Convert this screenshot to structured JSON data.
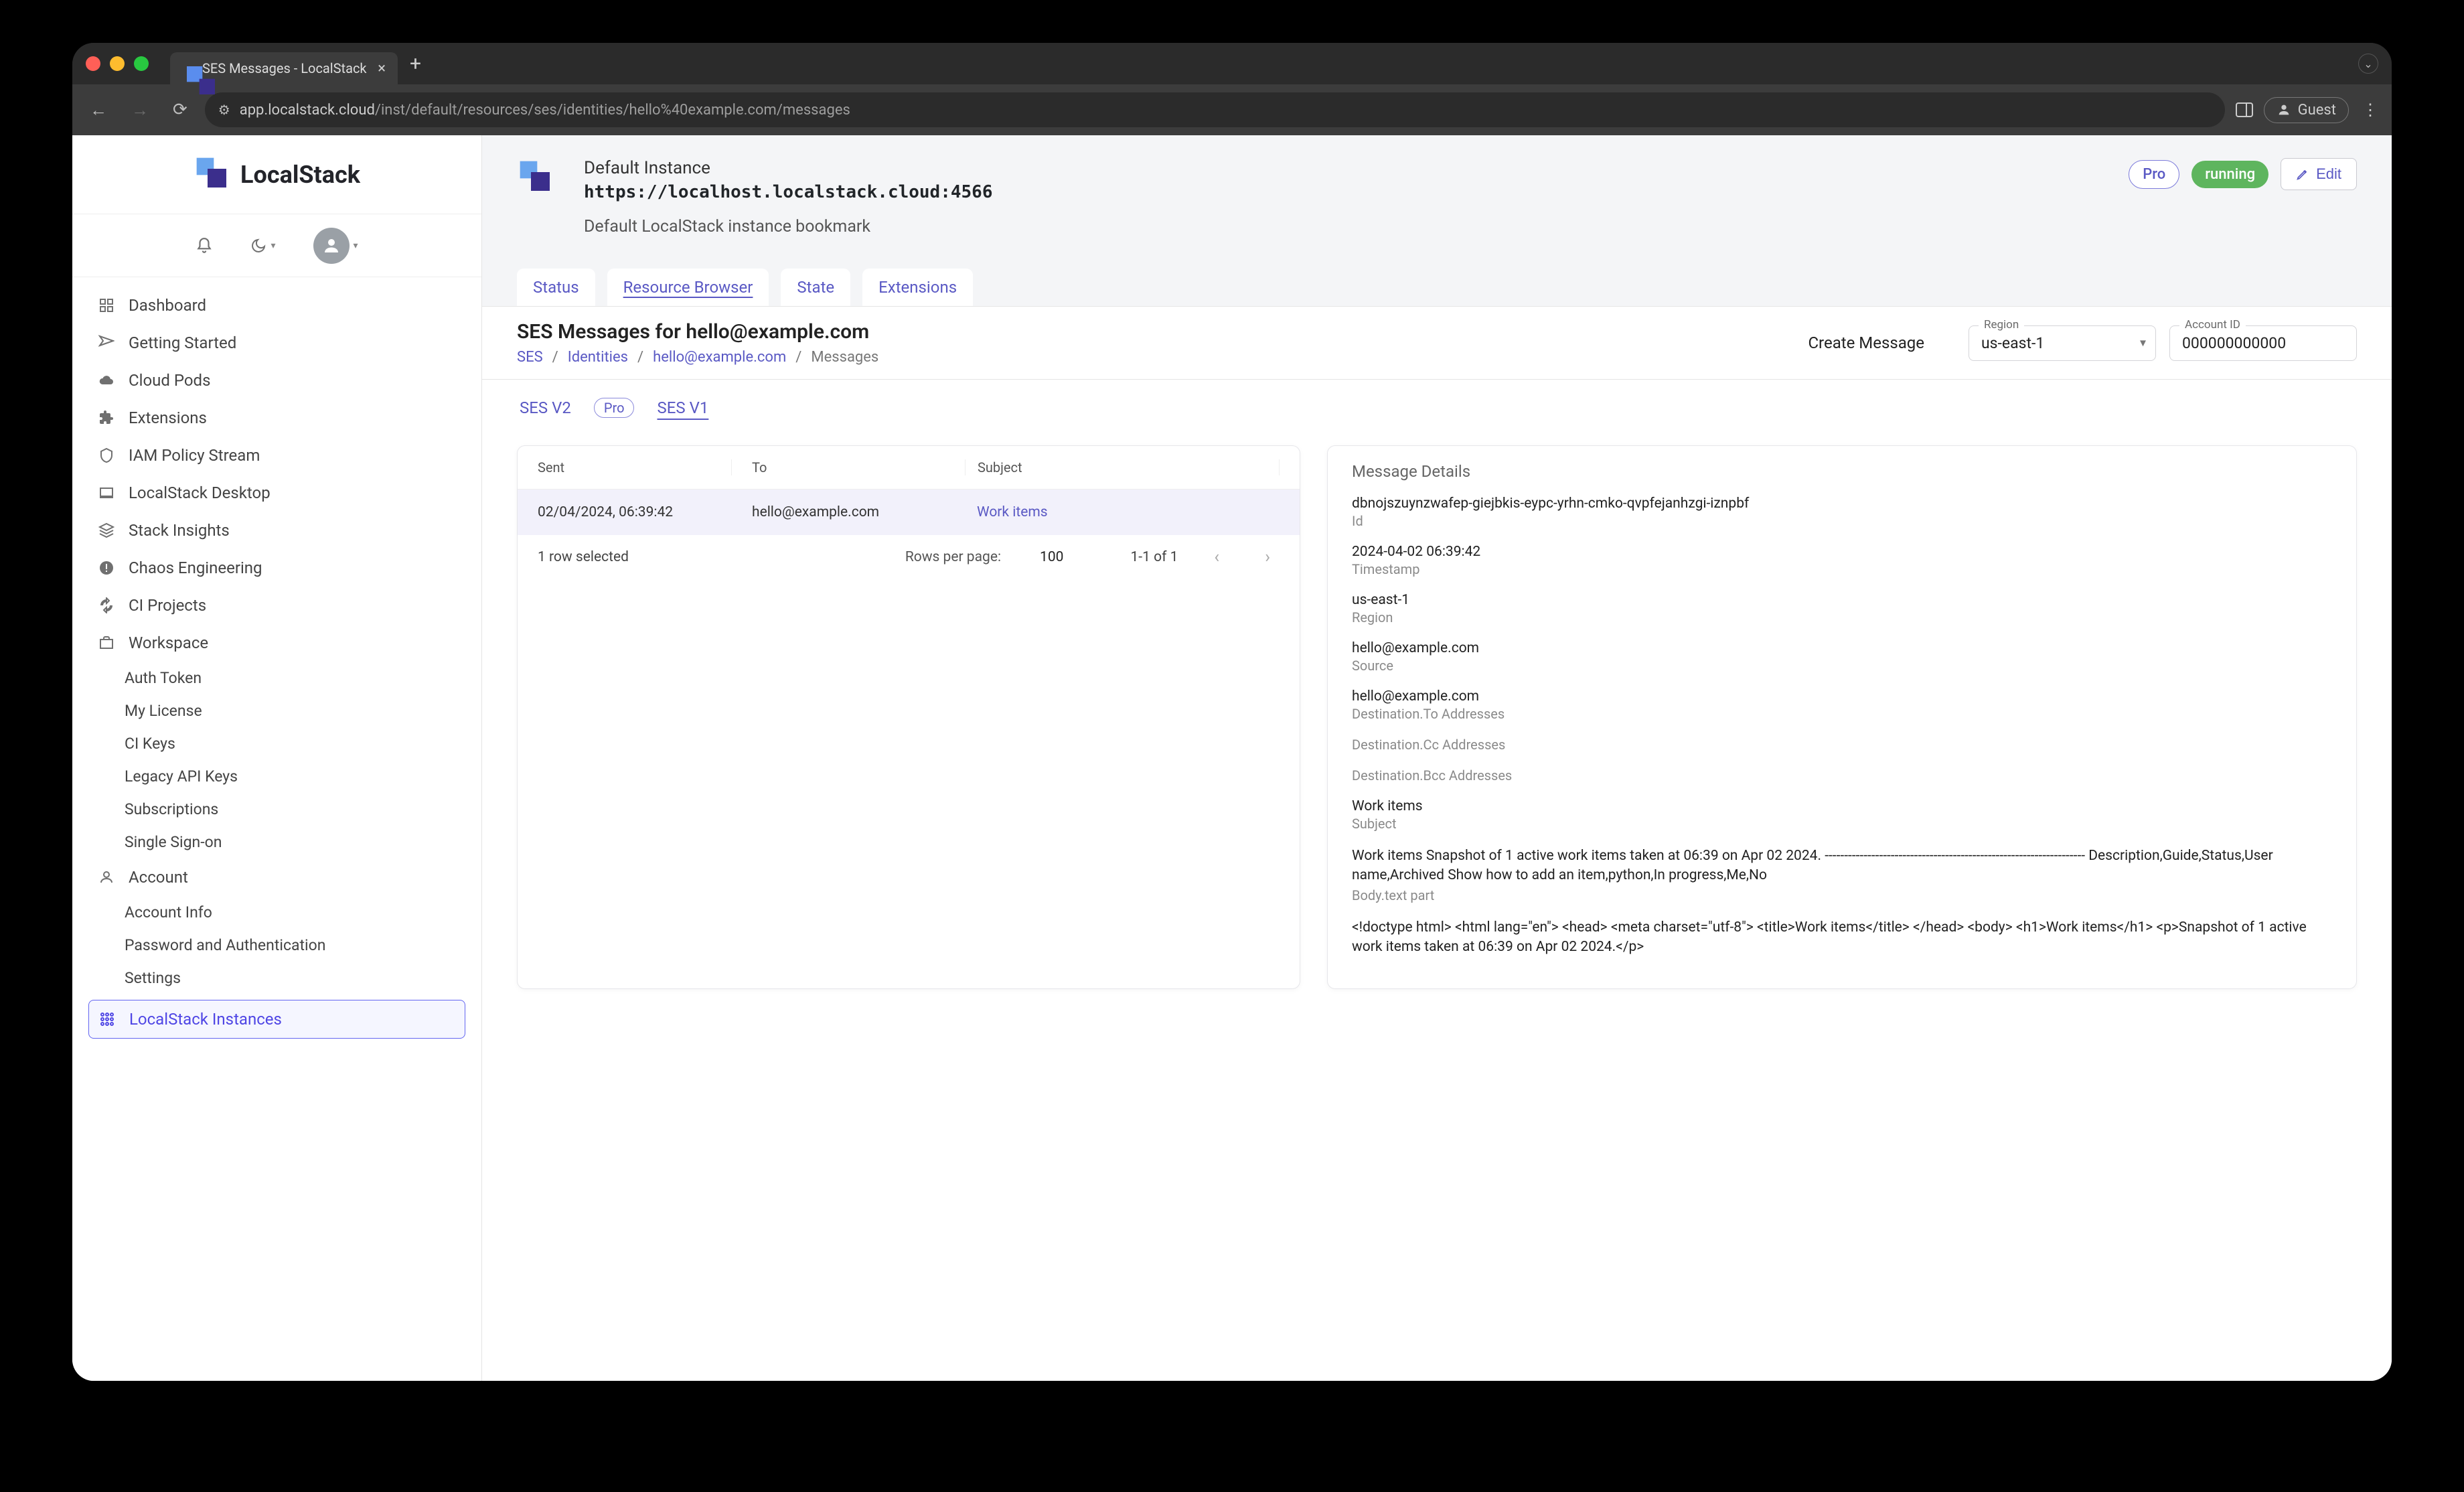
{
  "browser": {
    "tab_title": "SES Messages - LocalStack",
    "url_host": "app.localstack.cloud",
    "url_path": "/inst/default/resources/ses/identities/hello%40example.com/messages",
    "guest_label": "Guest"
  },
  "brand": {
    "name": "LocalStack"
  },
  "sidebar": {
    "items": [
      {
        "label": "Dashboard"
      },
      {
        "label": "Getting Started"
      },
      {
        "label": "Cloud Pods"
      },
      {
        "label": "Extensions"
      },
      {
        "label": "IAM Policy Stream"
      },
      {
        "label": "LocalStack Desktop"
      },
      {
        "label": "Stack Insights"
      },
      {
        "label": "Chaos Engineering"
      },
      {
        "label": "CI Projects"
      },
      {
        "label": "Workspace"
      }
    ],
    "workspace_sub": [
      {
        "label": "Auth Token"
      },
      {
        "label": "My License"
      },
      {
        "label": "CI Keys"
      },
      {
        "label": "Legacy API Keys"
      },
      {
        "label": "Subscriptions"
      },
      {
        "label": "Single Sign-on"
      }
    ],
    "account_label": "Account",
    "account_sub": [
      {
        "label": "Account Info"
      },
      {
        "label": "Password and Authentication"
      },
      {
        "label": "Settings"
      }
    ],
    "instances_label": "LocalStack Instances"
  },
  "header": {
    "instance_name": "Default Instance",
    "instance_url": "https://localhost.localstack.cloud:4566",
    "instance_desc": "Default LocalStack instance bookmark",
    "pro_label": "Pro",
    "running_label": "running",
    "edit_label": "Edit",
    "tabs": [
      {
        "label": "Status"
      },
      {
        "label": "Resource Browser"
      },
      {
        "label": "State"
      },
      {
        "label": "Extensions"
      }
    ]
  },
  "page": {
    "title": "SES Messages for hello@example.com",
    "crumbs": {
      "ses": "SES",
      "identities": "Identities",
      "email": "hello@example.com",
      "messages": "Messages"
    },
    "create_label": "Create Message",
    "region_label": "Region",
    "region_value": "us-east-1",
    "account_label": "Account ID",
    "account_value": "000000000000"
  },
  "subtabs": {
    "v2": "SES V2",
    "pro": "Pro",
    "v1": "SES V1"
  },
  "table": {
    "columns": {
      "sent": "Sent",
      "to": "To",
      "subject": "Subject"
    },
    "rows": [
      {
        "sent": "02/04/2024, 06:39:42",
        "to": "hello@example.com",
        "subject": "Work items"
      }
    ],
    "footer": {
      "selected": "1 row selected",
      "rpp_label": "Rows per page:",
      "rpp_value": "100",
      "range": "1-1 of 1"
    }
  },
  "details": {
    "title": "Message Details",
    "id_value": "dbnojszuynzwafep-giejbkis-eypc-yrhn-cmko-qvpfejanhzgi-iznpbf",
    "id_label": "Id",
    "ts_value": "2024-04-02 06:39:42",
    "ts_label": "Timestamp",
    "region_value": "us-east-1",
    "region_label": "Region",
    "source_value": "hello@example.com",
    "source_label": "Source",
    "to_value": "hello@example.com",
    "to_label": "Destination.To Addresses",
    "cc_label": "Destination.Cc Addresses",
    "bcc_label": "Destination.Bcc Addresses",
    "subject_value": "Work items",
    "subject_label": "Subject",
    "body_text": "Work items Snapshot of 1 active work items taken at 06:39 on Apr 02 2024. ------------------------------------------------------------------- Description,Guide,Status,User name,Archived Show how to add an item,python,In progress,Me,No",
    "body_text_label": "Body.text part",
    "body_html": "<!doctype html> <html lang=\"en\"> <head> <meta charset=\"utf-8\"> <title>Work items</title> </head> <body> <h1>Work items</h1> <p>Snapshot of 1 active work items taken at 06:39 on Apr 02 2024.</p>"
  }
}
